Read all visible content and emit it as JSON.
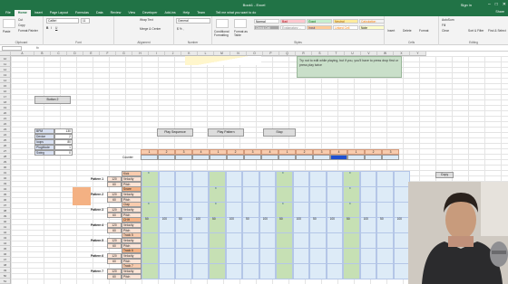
{
  "titlebar": {
    "title": "Book1 - Excel",
    "account": "Sign in",
    "controls": [
      "–",
      "□",
      "✕"
    ]
  },
  "tabs": [
    "File",
    "Home",
    "Insert",
    "Page Layout",
    "Formulas",
    "Data",
    "Review",
    "View",
    "Developer",
    "Add-ins",
    "Help",
    "Team"
  ],
  "active_tab": "Home",
  "tell_me": "Tell me what you want to do",
  "share": "Share",
  "ribbon": {
    "clipboard": {
      "label": "Clipboard",
      "paste": "Paste",
      "cut": "Cut",
      "copy": "Copy",
      "format_painter": "Format Painter"
    },
    "font": {
      "label": "Font",
      "name": "Calibri",
      "size": "11"
    },
    "alignment": {
      "label": "Alignment",
      "wrap": "Wrap Text",
      "merge": "Merge & Center"
    },
    "number": {
      "label": "Number",
      "format": "General",
      "symbols": "$ % ,"
    },
    "styles": {
      "label": "Styles",
      "conditional": "Conditional Formatting",
      "format_table": "Format as Table",
      "items": [
        {
          "name": "Normal",
          "bg": "#ffffff",
          "fg": "#000000"
        },
        {
          "name": "Bad",
          "bg": "#ffc7ce",
          "fg": "#9c0006"
        },
        {
          "name": "Good",
          "bg": "#c6efce",
          "fg": "#006100"
        },
        {
          "name": "Neutral",
          "bg": "#ffeb9c",
          "fg": "#9c5700"
        },
        {
          "name": "Calculation",
          "bg": "#f2f2f2",
          "fg": "#fa7d00"
        },
        {
          "name": "Check Cell",
          "bg": "#a5a5a5",
          "fg": "#ffffff"
        },
        {
          "name": "Explanatory ...",
          "bg": "#ffffff",
          "fg": "#7f7f7f"
        },
        {
          "name": "Input",
          "bg": "#ffcc99",
          "fg": "#3f3f76"
        },
        {
          "name": "Linked Cell",
          "bg": "#ffffff",
          "fg": "#fa7d00"
        },
        {
          "name": "Note",
          "bg": "#ffffcc",
          "fg": "#000000"
        }
      ]
    },
    "cells": {
      "label": "Cells",
      "insert": "Insert",
      "delete": "Delete",
      "format": "Format"
    },
    "editing": {
      "label": "Editing",
      "autosum": "AutoSum",
      "fill": "Fill",
      "clear": "Clear",
      "sort": "Sort & Filter",
      "find": "Find & Select"
    }
  },
  "formula_bar": {
    "name_box": "",
    "fx": "fx"
  },
  "columns": [
    "A",
    "B",
    "C",
    "D",
    "E",
    "F",
    "G",
    "H",
    "I",
    "J",
    "K",
    "L",
    "M",
    "N",
    "O",
    "P",
    "Q",
    "R",
    "S",
    "T",
    "U",
    "V",
    "W",
    "X",
    "Y"
  ],
  "rows": [
    "10",
    "11",
    "12",
    "13",
    "14",
    "15",
    "16",
    "17",
    "18",
    "19",
    "20",
    "21",
    "22",
    "23",
    "24",
    "25",
    "26",
    "27",
    "28",
    "29",
    "30",
    "31",
    "32",
    "33",
    "34",
    "35",
    "36",
    "37",
    "38",
    "39",
    "40",
    "41",
    "42",
    "43",
    "44",
    "45",
    "46",
    "47",
    "48",
    "49",
    "50",
    "51"
  ],
  "note": "Try not to edit while playing, but if you, you'll have to press drop first or press play twice",
  "buttons": {
    "button2": "Button 2",
    "play_sequence": "Play Sequence",
    "play_pattern": "Play Pattern",
    "stop": "Stop",
    "copy": "Copy"
  },
  "settings": [
    {
      "label": "BPM",
      "value": "130"
    },
    {
      "label": "Device",
      "value": "2"
    },
    {
      "label": "loops",
      "value": "80"
    },
    {
      "label": "PlugMode",
      "value": "1"
    },
    {
      "label": "Swing",
      "value": "0"
    }
  ],
  "counter_label": "Counter",
  "sequence_steps": [
    "1",
    "2",
    "3",
    "4",
    "1",
    "2",
    "3",
    "4",
    "1",
    "2",
    "3",
    "4",
    "1",
    "2",
    "3"
  ],
  "patterns": [
    {
      "name": "Pattern 1",
      "vel": "120",
      "pitch": "60",
      "track": "Kick"
    },
    {
      "name": "Pattern 2",
      "vel": "120",
      "pitch": "60",
      "track": "Snare"
    },
    {
      "name": "Pattern 3",
      "vel": "120",
      "pitch": "60",
      "track": "Clap"
    },
    {
      "name": "Pattern 4",
      "vel": "120",
      "pitch": "60",
      "track": "CHH"
    },
    {
      "name": "Pattern 5",
      "vel": "120",
      "pitch": "60",
      "track": "Track 5"
    },
    {
      "name": "Pattern 6",
      "vel": "120",
      "pitch": "60",
      "track": "Track 6"
    },
    {
      "name": "Pattern 7",
      "vel": "120",
      "pitch": "60",
      "track": "Track 7"
    }
  ],
  "vel_label": "Velocity",
  "pitch_label": "Pitch",
  "step_values": [
    "50",
    "100",
    "50",
    "100",
    "50",
    "100",
    "50",
    "100",
    "50",
    "100",
    "50",
    "100",
    "50",
    "100",
    "50",
    "100"
  ],
  "marker": "x"
}
